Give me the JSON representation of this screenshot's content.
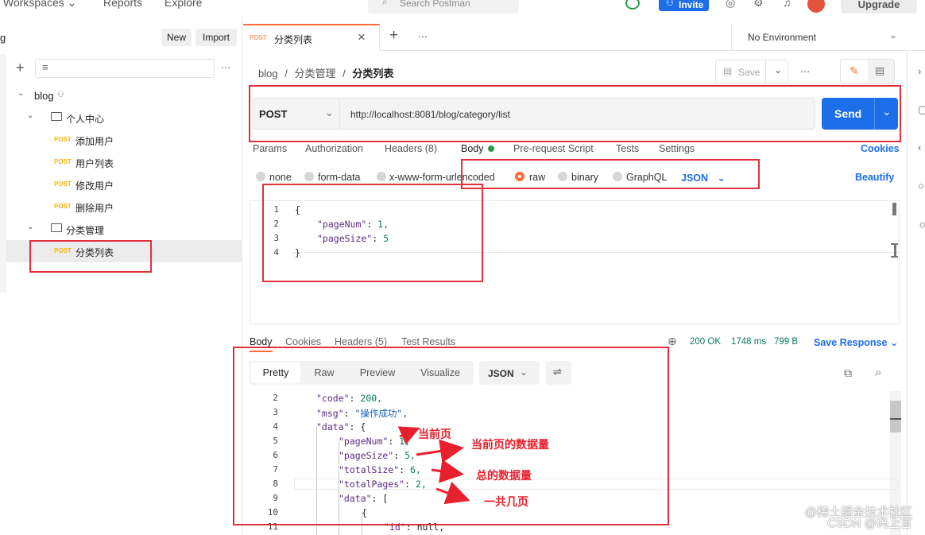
{
  "topbar": {
    "workspaces": "Workspaces",
    "reports": "Reports",
    "explore": "Explore",
    "search_placeholder": "Search Postman",
    "invite": "Invite",
    "upgrade": "Upgrade"
  },
  "sidebar": {
    "new_label": "New",
    "import_label": "Import",
    "more": "⋯",
    "workspace_name": "blog",
    "tree": [
      {
        "type": "collection",
        "label": "blog"
      },
      {
        "type": "folder",
        "label": "个人中心"
      },
      {
        "type": "request",
        "method": "POST",
        "label": "添加用户"
      },
      {
        "type": "request",
        "method": "POST",
        "label": "用户列表"
      },
      {
        "type": "request",
        "method": "POST",
        "label": "修改用户"
      },
      {
        "type": "request",
        "method": "POST",
        "label": "删除用户"
      },
      {
        "type": "folder",
        "label": "分类管理"
      },
      {
        "type": "request",
        "method": "POST",
        "label": "分类列表"
      }
    ]
  },
  "tabs": {
    "active": {
      "method": "POST",
      "label": "分类列表"
    },
    "add": "+",
    "more": "⋯",
    "environment": "No Environment"
  },
  "breadcrumb": {
    "parts": [
      "blog",
      "分类管理",
      "分类列表"
    ],
    "separator": "/"
  },
  "toolbar": {
    "save_label": "Save",
    "more": "⋯"
  },
  "request": {
    "method": "POST",
    "url": "http://localhost:8081/blog/category/list",
    "send_label": "Send",
    "tabs": [
      "Params",
      "Authorization",
      "Headers (8)",
      "Body",
      "Pre-request Script",
      "Tests",
      "Settings"
    ],
    "cookies_label": "Cookies",
    "body_modes": [
      "none",
      "form-data",
      "x-www-form-urlencoded",
      "raw",
      "binary",
      "GraphQL"
    ],
    "selected_body_mode": "raw",
    "body_format": "JSON",
    "beautify_label": "Beautify",
    "body_lines": [
      {
        "no": "1",
        "text": "{"
      },
      {
        "no": "2",
        "key": "\"pageNum\"",
        "value": "1,"
      },
      {
        "no": "3",
        "key": "\"pageSize\"",
        "value": "5"
      },
      {
        "no": "4",
        "text": "}"
      }
    ]
  },
  "response": {
    "tabs": [
      "Body",
      "Cookies",
      "Headers (5)",
      "Test Results"
    ],
    "status": "200 OK",
    "time": "1748 ms",
    "size": "799 B",
    "save_response": "Save Response",
    "views": [
      "Pretty",
      "Raw",
      "Preview",
      "Visualize"
    ],
    "format": "JSON",
    "lines": [
      {
        "no": "2",
        "key": "\"code\"",
        "value": "200,"
      },
      {
        "no": "3",
        "key": "\"msg\"",
        "value": "\"操作成功\","
      },
      {
        "no": "4",
        "key": "\"data\"",
        "value": "{"
      },
      {
        "no": "5",
        "key": "\"pageNum\"",
        "value": "1,"
      },
      {
        "no": "6",
        "key": "\"pageSize\"",
        "value": "5,"
      },
      {
        "no": "7",
        "key": "\"totalSize\"",
        "value": "6,"
      },
      {
        "no": "8",
        "key": "\"totalPages\"",
        "value": "2,"
      },
      {
        "no": "9",
        "key": "\"data\"",
        "value": "["
      },
      {
        "no": "10",
        "text": "{"
      },
      {
        "no": "11",
        "key": "\"id\"",
        "value": "null,"
      }
    ]
  },
  "annotations": {
    "current_page": "当前页",
    "current_page_count": "当前页的数据量",
    "total_count": "总的数据量",
    "total_pages": "一共几页"
  },
  "watermark": {
    "line1": "@稀土掘金技术社区",
    "line2": "CSDN @码上言"
  },
  "colors": {
    "accent": "#1d6ee9",
    "postman_orange": "#ff6c37",
    "method_post": "#ffb400",
    "annotation_red": "#e0313c",
    "status_ok": "#0b7a61"
  }
}
